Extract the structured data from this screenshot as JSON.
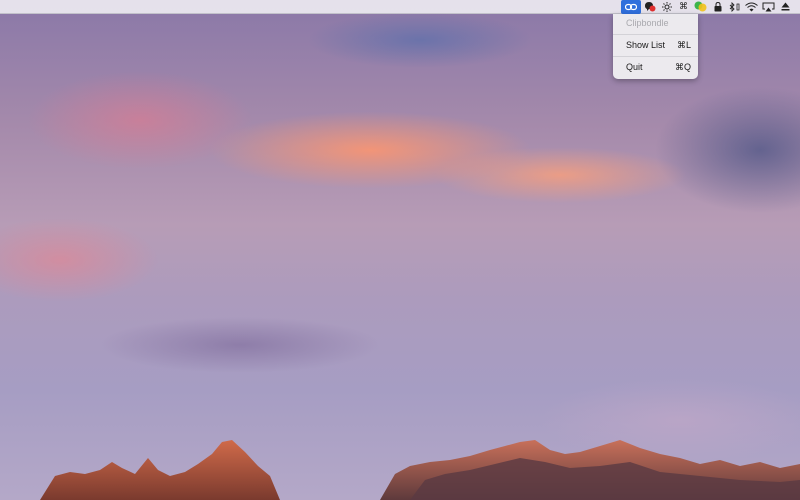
{
  "menubar": {
    "status_items": [
      {
        "icon": "clipboard-chain-icon",
        "active": true
      },
      {
        "icon": "notification-badge-icon",
        "active": false
      },
      {
        "icon": "brightness-sun-icon",
        "active": false
      },
      {
        "icon": "command-icon",
        "glyph": "⌘",
        "active": false
      },
      {
        "icon": "overlapping-circles-icon",
        "active": false
      },
      {
        "icon": "lock-icon",
        "active": false
      },
      {
        "icon": "bluetooth-icon",
        "active": false
      },
      {
        "icon": "wifi-icon",
        "active": false
      },
      {
        "icon": "airplay-icon",
        "active": false
      },
      {
        "icon": "eject-icon",
        "active": false
      }
    ]
  },
  "dropdown": {
    "header": "Clipbondle",
    "items": [
      {
        "label": "Show List",
        "shortcut": "⌘L"
      },
      {
        "label": "Quit",
        "shortcut": "⌘Q"
      }
    ]
  },
  "colors": {
    "menubar_bg": "#ECEAF0",
    "active_highlight": "#2F6FDC",
    "menu_bg": "#EEEDF1",
    "disabled_text": "#A9A9AE"
  }
}
